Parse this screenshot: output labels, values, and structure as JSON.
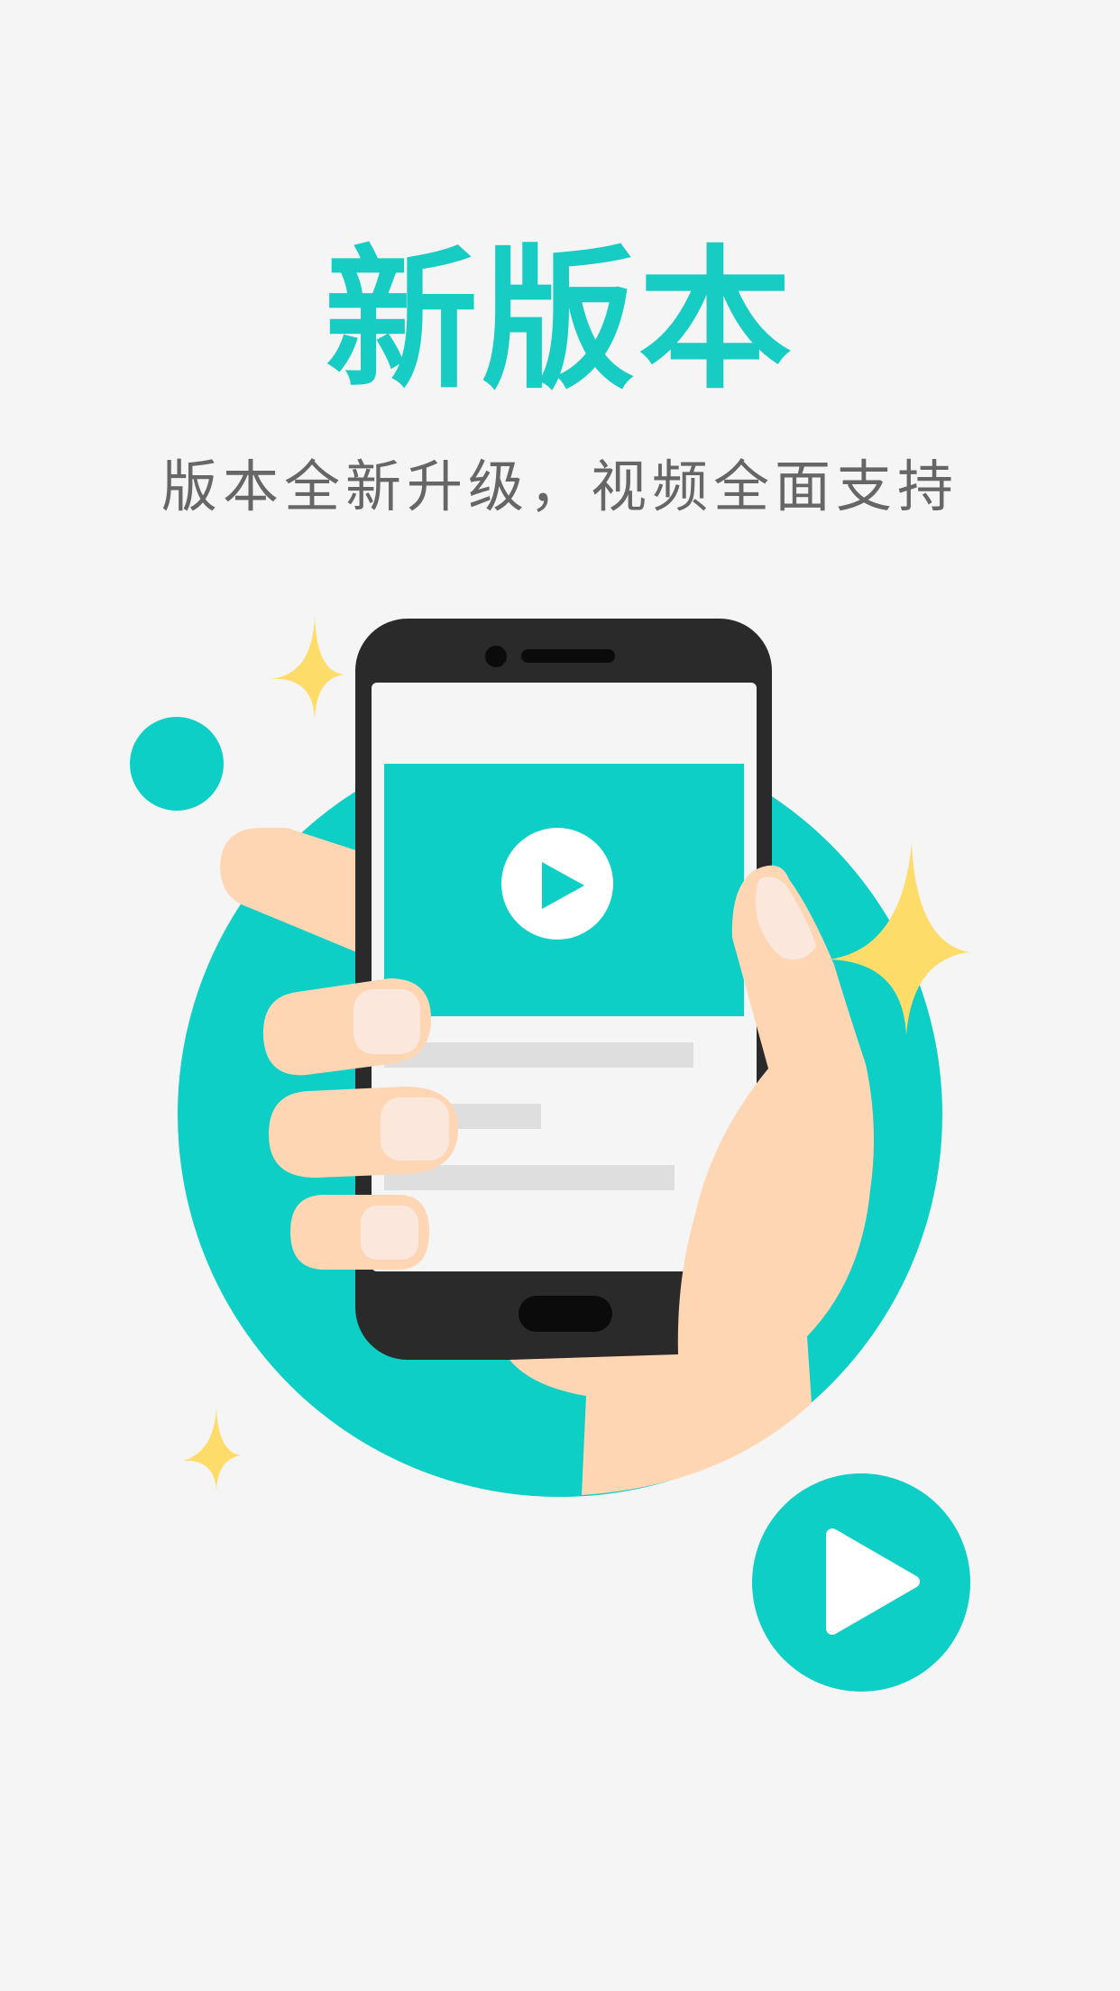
{
  "header": {
    "title": "新版本",
    "subtitle": "版本全新升级，视频全面支持"
  },
  "illustration": {
    "icons": [
      "sparkle-icon",
      "phone-icon",
      "play-icon",
      "hand-icon"
    ]
  },
  "colors": {
    "accent": "#0dcfc6",
    "star": "#fedc6a",
    "skin": "#fed6b4",
    "phone": "#2a2a2a",
    "background": "#f5f5f5"
  }
}
